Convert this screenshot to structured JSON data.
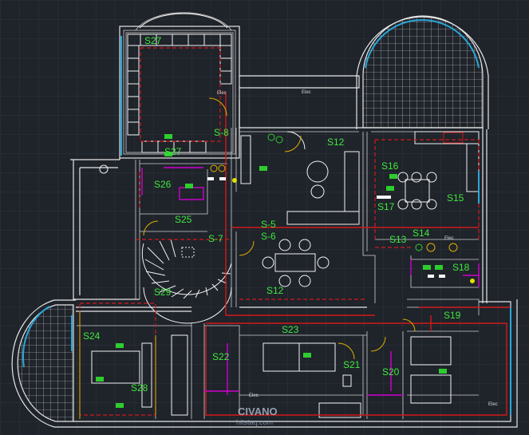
{
  "rooms": [
    {
      "id": "S27",
      "text": "S27"
    },
    {
      "id": "S27b",
      "text": "S27"
    },
    {
      "id": "S8",
      "text": "S-8"
    },
    {
      "id": "S12a",
      "text": "S12"
    },
    {
      "id": "S16",
      "text": "S16"
    },
    {
      "id": "S17",
      "text": "S17"
    },
    {
      "id": "S15",
      "text": "S15"
    },
    {
      "id": "S26",
      "text": "S26"
    },
    {
      "id": "S25",
      "text": "S25"
    },
    {
      "id": "S5",
      "text": "S-5"
    },
    {
      "id": "S6",
      "text": "S-6"
    },
    {
      "id": "S13",
      "text": "S13"
    },
    {
      "id": "S14",
      "text": "S14"
    },
    {
      "id": "S7",
      "text": "S-7"
    },
    {
      "id": "S18",
      "text": "S18"
    },
    {
      "id": "S12b",
      "text": "S12"
    },
    {
      "id": "S29",
      "text": "S29"
    },
    {
      "id": "S19",
      "text": "S19"
    },
    {
      "id": "S23",
      "text": "S23"
    },
    {
      "id": "S24",
      "text": "S24"
    },
    {
      "id": "S22",
      "text": "S22"
    },
    {
      "id": "S21",
      "text": "S21"
    },
    {
      "id": "S20",
      "text": "S20"
    },
    {
      "id": "S28",
      "text": "S28"
    }
  ],
  "tags": {
    "elec": "Elec"
  },
  "watermark": {
    "main": "CIVANO",
    "sub": "hitstaq.com"
  },
  "colors": {
    "background": "#1f232a",
    "walls": "#e6e6e6",
    "labels": "#3fe83f",
    "wiring": "#d11a1a",
    "windows": "#2aa7d8",
    "plumbing": "#d000d0"
  }
}
